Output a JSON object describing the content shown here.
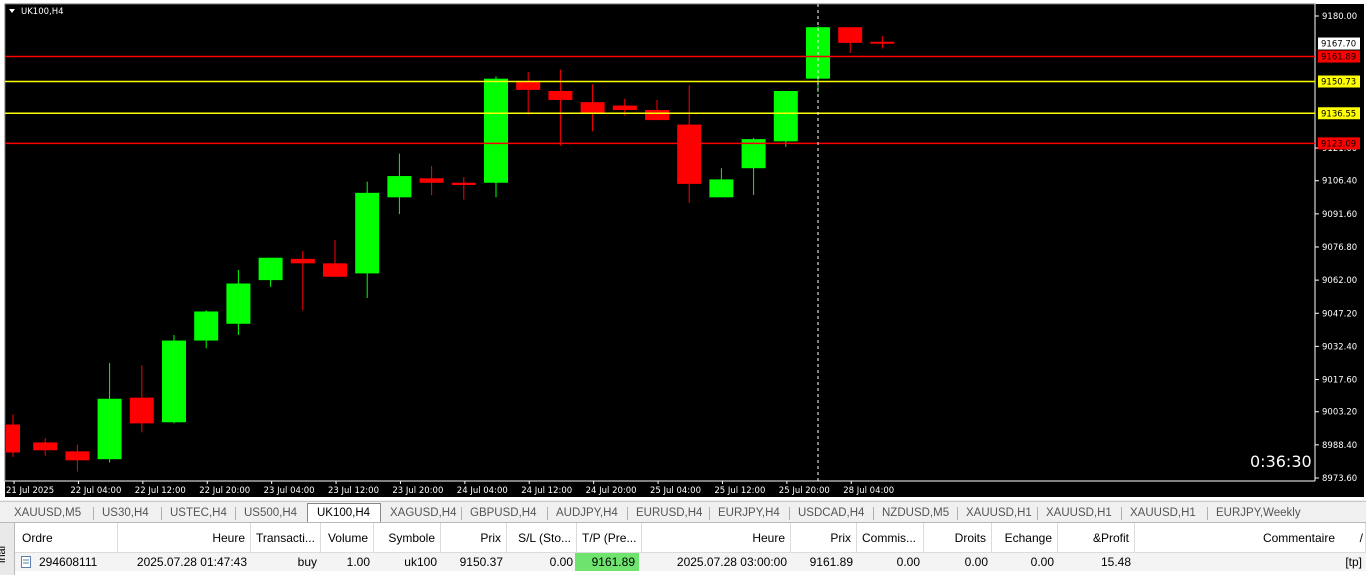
{
  "chart": {
    "symbol_label": "UK100,H4",
    "timer": "0:36:30",
    "colors": {
      "bull": "#00ff00",
      "bear": "#ff0000",
      "hline_red": "#ff0000",
      "hline_yellow": "#ffff00",
      "crosshair": "#ffffff"
    },
    "price_scale": {
      "ticks": [
        "9180.00",
        "9121.00",
        "9106.40",
        "9091.60",
        "9076.80",
        "9062.00",
        "9047.20",
        "9032.40",
        "9017.60",
        "9003.20",
        "8988.40",
        "8973.60"
      ],
      "min": 8973.6,
      "max": 9180.0
    },
    "time_labels": [
      "21 Jul 2025",
      "22 Jul 04:00",
      "22 Jul 12:00",
      "22 Jul 20:00",
      "23 Jul 04:00",
      "23 Jul 12:00",
      "23 Jul 20:00",
      "24 Jul 04:00",
      "24 Jul 12:00",
      "24 Jul 20:00",
      "25 Jul 04:00",
      "25 Jul 12:00",
      "25 Jul 20:00",
      "28 Jul 04:00"
    ],
    "price_tags": [
      {
        "text": "9167.70",
        "price": 9167.7,
        "bg": "#ffffff",
        "fg": "#000000"
      },
      {
        "text": "9161.89",
        "price": 9161.89,
        "bg": "#ff0000",
        "fg": "#000000"
      },
      {
        "text": "9150.73",
        "price": 9150.73,
        "bg": "#ffff00",
        "fg": "#000000"
      },
      {
        "text": "9136.55",
        "price": 9136.55,
        "bg": "#ffff00",
        "fg": "#000000"
      },
      {
        "text": "9123.09",
        "price": 9123.09,
        "bg": "#ff0000",
        "fg": "#000000"
      }
    ],
    "hlines": [
      {
        "price": 9161.89,
        "color": "#ff0000"
      },
      {
        "price": 9150.73,
        "color": "#ffff00"
      },
      {
        "price": 9136.55,
        "color": "#ffff00"
      },
      {
        "price": 9123.09,
        "color": "#ff0000"
      }
    ],
    "crosshair_candle": 25
  },
  "chart_data": {
    "type": "candlestick",
    "title": "UK100,H4",
    "xlabel": "",
    "ylabel": "",
    "ylim": [
      8973.6,
      9180.0
    ],
    "candles": [
      {
        "o": 8997.5,
        "h": 9002.0,
        "l": 8983.0,
        "c": 8985.0
      },
      {
        "o": 8989.5,
        "h": 8991.5,
        "l": 8983.5,
        "c": 8986.0
      },
      {
        "o": 8985.5,
        "h": 8988.5,
        "l": 8976.5,
        "c": 8981.5
      },
      {
        "o": 8982.0,
        "h": 9025.0,
        "l": 8980.5,
        "c": 9009.0
      },
      {
        "o": 9009.5,
        "h": 9024.0,
        "l": 8994.0,
        "c": 8998.0
      },
      {
        "o": 8998.5,
        "h": 9037.5,
        "l": 8998.0,
        "c": 9035.0
      },
      {
        "o": 9035.0,
        "h": 9048.5,
        "l": 9031.5,
        "c": 9048.0
      },
      {
        "o": 9042.5,
        "h": 9066.5,
        "l": 9037.5,
        "c": 9060.5
      },
      {
        "o": 9062.0,
        "h": 9072.0,
        "l": 9059.0,
        "c": 9072.0
      },
      {
        "o": 9071.5,
        "h": 9075.0,
        "l": 9048.5,
        "c": 9069.5
      },
      {
        "o": 9069.5,
        "h": 9080.0,
        "l": 9063.5,
        "c": 9063.5
      },
      {
        "o": 9065.0,
        "h": 9106.0,
        "l": 9054.0,
        "c": 9101.0
      },
      {
        "o": 9099.0,
        "h": 9118.5,
        "l": 9091.5,
        "c": 9108.5
      },
      {
        "o": 9107.5,
        "h": 9113.0,
        "l": 9100.0,
        "c": 9105.5
      },
      {
        "o": 9105.5,
        "h": 9108.0,
        "l": 9098.0,
        "c": 9104.5
      },
      {
        "o": 9105.5,
        "h": 9153.0,
        "l": 9099.0,
        "c": 9152.0
      },
      {
        "o": 9151.0,
        "h": 9155.0,
        "l": 9136.0,
        "c": 9147.0
      },
      {
        "o": 9146.5,
        "h": 9156.0,
        "l": 9122.0,
        "c": 9142.5
      },
      {
        "o": 9141.5,
        "h": 9149.5,
        "l": 9128.5,
        "c": 9136.5
      },
      {
        "o": 9140.0,
        "h": 9143.0,
        "l": 9135.5,
        "c": 9138.0
      },
      {
        "o": 9138.0,
        "h": 9142.5,
        "l": 9133.5,
        "c": 9133.5
      },
      {
        "o": 9131.5,
        "h": 9149.0,
        "l": 9096.5,
        "c": 9105.0
      },
      {
        "o": 9099.0,
        "h": 9112.0,
        "l": 9099.0,
        "c": 9107.0
      },
      {
        "o": 9112.0,
        "h": 9125.5,
        "l": 9100.0,
        "c": 9125.0
      },
      {
        "o": 9124.0,
        "h": 9145.5,
        "l": 9121.5,
        "c": 9146.5
      },
      {
        "o": 9152.0,
        "h": 9175.5,
        "l": 9146.0,
        "c": 9175.0
      },
      {
        "o": 9175.0,
        "h": 9175.0,
        "l": 9163.5,
        "c": 9168.0
      },
      {
        "o": 9168.5,
        "h": 9171.0,
        "l": 9165.5,
        "c": 9167.7
      }
    ]
  },
  "tabs": [
    {
      "label": "XAUUSD,M5",
      "active": false
    },
    {
      "label": "US30,H4",
      "active": false
    },
    {
      "label": "USTEC,H4",
      "active": false
    },
    {
      "label": "US500,H4",
      "active": false
    },
    {
      "label": "UK100,H4",
      "active": true
    },
    {
      "label": "XAGUSD,H4",
      "active": false
    },
    {
      "label": "GBPUSD,H4",
      "active": false
    },
    {
      "label": "AUDJPY,H4",
      "active": false
    },
    {
      "label": "EURUSD,H4",
      "active": false
    },
    {
      "label": "EURJPY,H4",
      "active": false
    },
    {
      "label": "USDCAD,H4",
      "active": false
    },
    {
      "label": "NZDUSD,M5",
      "active": false
    },
    {
      "label": "XAUUSD,H1",
      "active": false
    },
    {
      "label": "XAUUSD,H1",
      "active": false
    },
    {
      "label": "XAUUSD,H1",
      "active": false
    },
    {
      "label": "EURJPY,Weekly",
      "active": false
    }
  ],
  "terminal": {
    "side_label": "inal",
    "columns": [
      "Ordre",
      "Heure",
      "Transacti...",
      "Volume",
      "Symbole",
      "Prix",
      "S/L (Sto...",
      "T/P (Pre...",
      "Heure",
      "Prix",
      "Commis...",
      "Droits",
      "Echange",
      "&Profit",
      "Commentaire"
    ],
    "sort_indicator": "/",
    "row": {
      "order": "294608111",
      "time_open": "2025.07.28 01:47:43",
      "type": "buy",
      "volume": "1.00",
      "symbol": "uk100",
      "price_open": "9150.37",
      "sl": "0.00",
      "tp": "9161.89",
      "time_close": "2025.07.28 03:00:00",
      "price_close": "9161.89",
      "commission": "0.00",
      "fees": "0.00",
      "swap": "0.00",
      "profit": "15.48",
      "comment": "[tp]"
    }
  }
}
